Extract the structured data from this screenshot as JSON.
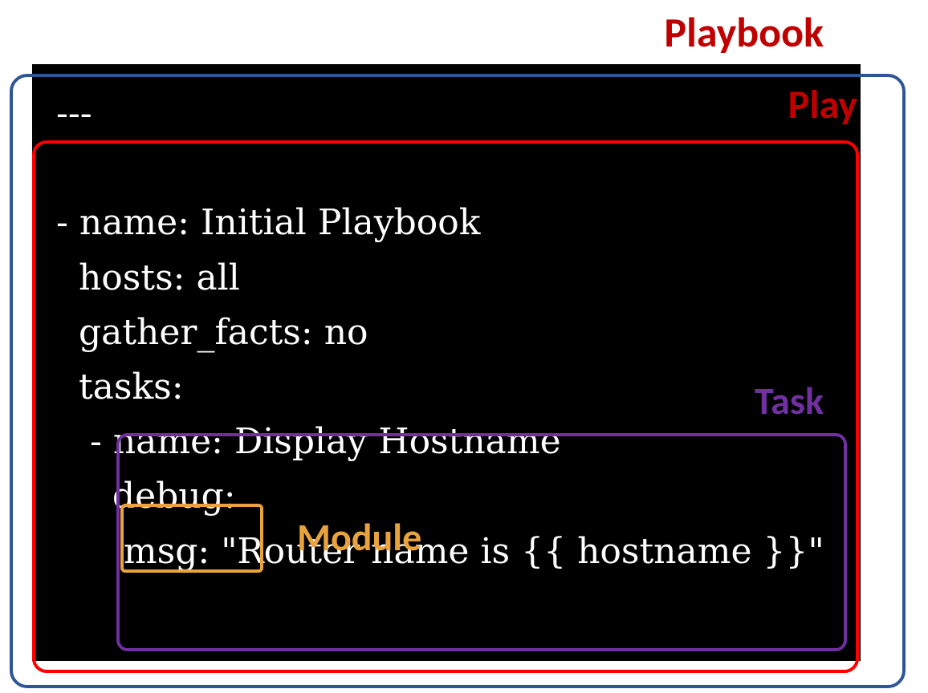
{
  "labels": {
    "playbook": "Playbook",
    "play": "Play",
    "task": "Task",
    "module": "Module"
  },
  "code": {
    "line1": "---",
    "line2": "",
    "line3": "- name: Initial Playbook",
    "line4": "  hosts: all",
    "line5": "  gather_facts: no",
    "line6": "  tasks:",
    "line7": "   - name: Display Hostname",
    "line8": "     debug:",
    "line9": "      msg: \"Router name is {{ hostname }}\""
  }
}
